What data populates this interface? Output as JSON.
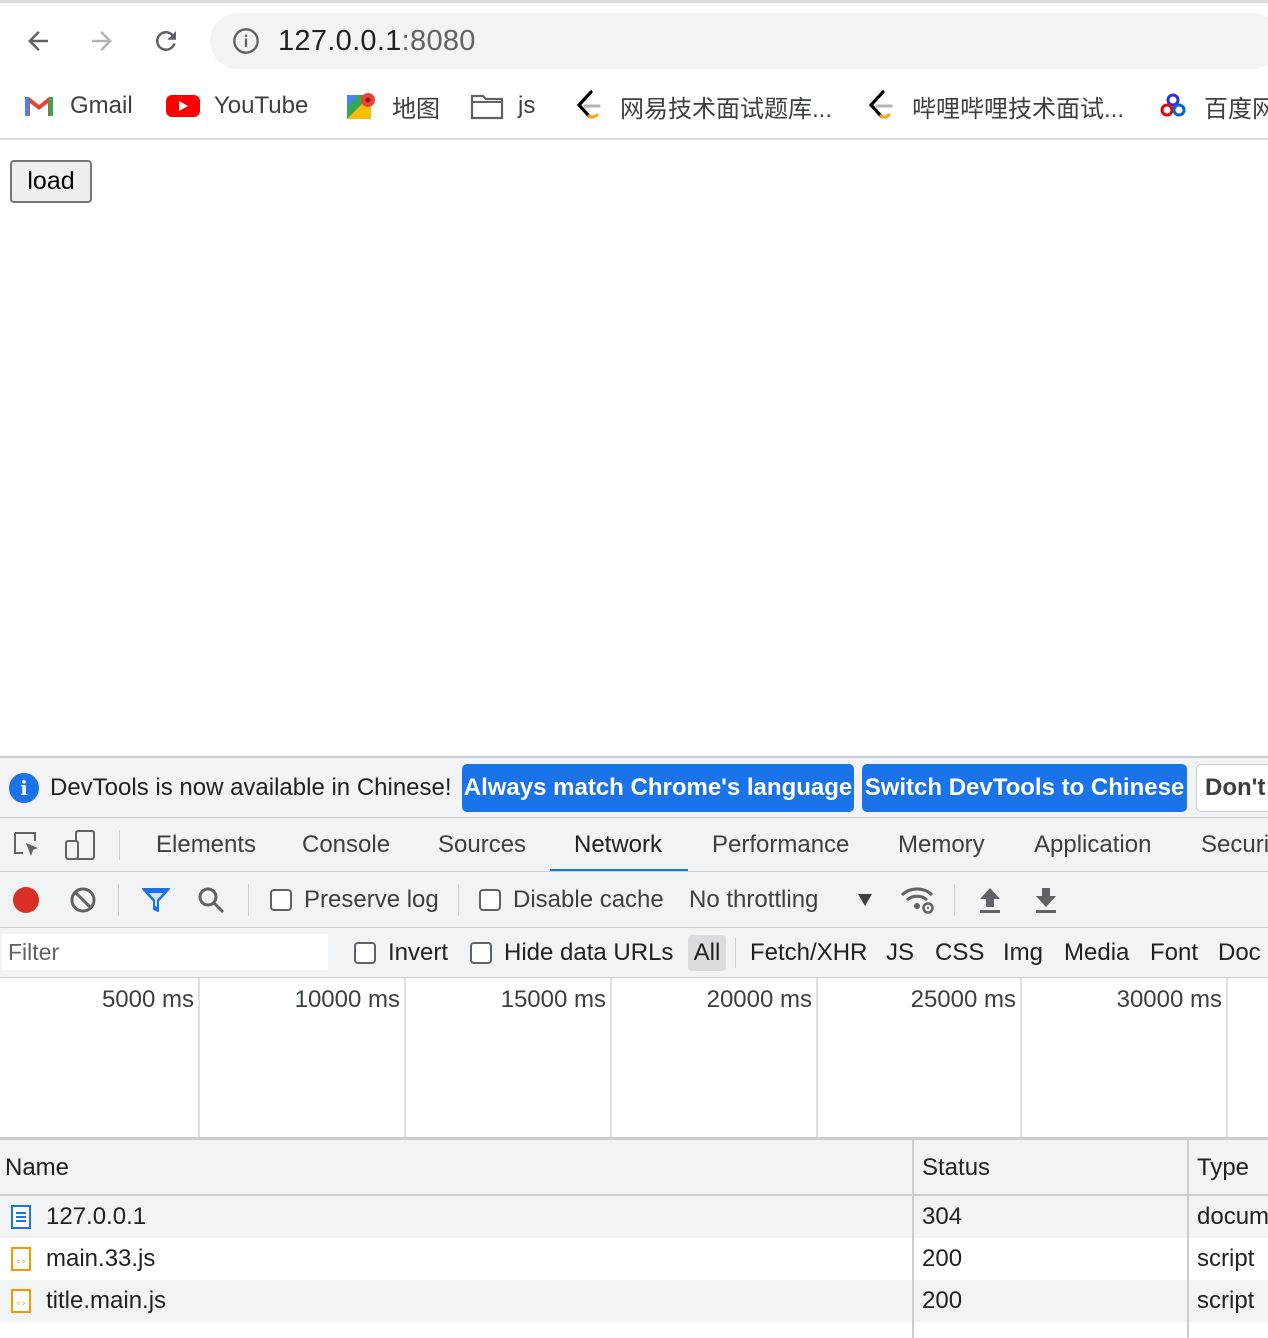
{
  "browser": {
    "url_host": "127.0.0.1",
    "url_port": ":8080",
    "icons": {
      "back": "arrow-left-icon",
      "forward": "arrow-right-icon",
      "reload": "reload-icon",
      "site_info": "info-circle-icon"
    }
  },
  "bookmarks": [
    {
      "label": "Gmail",
      "icon": "gmail-icon"
    },
    {
      "label": "YouTube",
      "icon": "youtube-icon"
    },
    {
      "label": "地图",
      "icon": "maps-icon"
    },
    {
      "label": "js",
      "icon": "folder-icon"
    },
    {
      "label": "网易技术面试题库...",
      "icon": "leetcode-icon"
    },
    {
      "label": "哔哩哔哩技术面试...",
      "icon": "leetcode-icon"
    },
    {
      "label": "百度网",
      "icon": "baidu-icon"
    }
  ],
  "page": {
    "load_button": "load"
  },
  "devtools": {
    "infobar": {
      "message": "DevTools is now available in Chinese!",
      "btn_match": "Always match Chrome's language",
      "btn_switch": "Switch DevTools to Chinese",
      "btn_dont": "Don't"
    },
    "tabs": [
      "Elements",
      "Console",
      "Sources",
      "Network",
      "Performance",
      "Memory",
      "Application",
      "Securi"
    ],
    "active_tab": "Network",
    "toolbar": {
      "preserve_log": "Preserve log",
      "disable_cache": "Disable cache",
      "throttling": "No throttling"
    },
    "filter": {
      "placeholder": "Filter",
      "invert": "Invert",
      "hide_data_urls": "Hide data URLs",
      "types": [
        "All",
        "Fetch/XHR",
        "JS",
        "CSS",
        "Img",
        "Media",
        "Font",
        "Doc"
      ]
    },
    "timeline_ticks": [
      "5000 ms",
      "10000 ms",
      "15000 ms",
      "20000 ms",
      "25000 ms",
      "30000 ms"
    ],
    "table": {
      "headers": {
        "name": "Name",
        "status": "Status",
        "type": "Type"
      },
      "rows": [
        {
          "name": "127.0.0.1",
          "status": "304",
          "type": "docum",
          "icon": "document-icon"
        },
        {
          "name": "main.33.js",
          "status": "200",
          "type": "script",
          "icon": "script-icon"
        },
        {
          "name": "title.main.js",
          "status": "200",
          "type": "script",
          "icon": "script-icon"
        }
      ]
    },
    "colors": {
      "accent": "#1a73e8",
      "record": "#d93025"
    }
  }
}
